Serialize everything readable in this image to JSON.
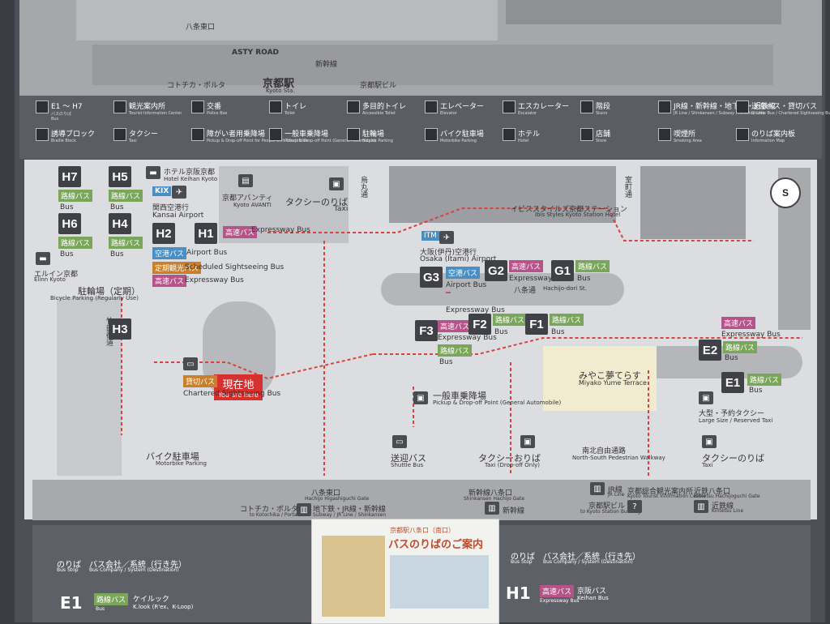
{
  "top_legend": {
    "row1": [
      {
        "key": "range",
        "label": "E1 〜 H7",
        "sub": "バスのりば",
        "sub2": "Bus"
      },
      {
        "key": "info",
        "label": "観光案内所",
        "sub": "Tourist Information Center"
      },
      {
        "key": "police",
        "label": "交番",
        "sub": "Police Box"
      },
      {
        "key": "toilet",
        "label": "トイレ",
        "sub": "Toilet"
      },
      {
        "key": "accessible",
        "label": "多目的トイレ",
        "sub": "Accessible Toilet"
      },
      {
        "key": "elevator",
        "label": "エレベーター",
        "sub": "Elevator"
      },
      {
        "key": "escalator",
        "label": "エスカレーター",
        "sub": "Escalator"
      },
      {
        "key": "stairs",
        "label": "階段",
        "sub": "Stairs"
      },
      {
        "key": "jr",
        "label": "JR線・新幹線・地下鉄・近鉄線",
        "sub": "JR Line / Shinkansen / Subway / Kintetsu Line"
      },
      {
        "key": "shuttle",
        "label": "送迎バス・貸切バス",
        "sub": "Shuttle Bus / Chartered Sightseeing Bus"
      }
    ],
    "row2": [
      {
        "key": "braille",
        "label": "誘導ブロック",
        "sub": "Braille Block"
      },
      {
        "key": "taxi",
        "label": "タクシー",
        "sub": "Taxi"
      },
      {
        "key": "disabled",
        "label": "障がい者用乗降場",
        "sub": "Pickup & Drop-off Point for People with Disabilities"
      },
      {
        "key": "car",
        "label": "一般車乗降場",
        "sub": "Pickup & Drop-off Point (General Automobile)"
      },
      {
        "key": "bicycle",
        "label": "駐輪場",
        "sub": "Bicycle Parking"
      },
      {
        "key": "moto",
        "label": "バイク駐車場",
        "sub": "Motorbike Parking"
      },
      {
        "key": "hotel",
        "label": "ホテル",
        "sub": "Hotel"
      },
      {
        "key": "store",
        "label": "店舗",
        "sub": "Store"
      },
      {
        "key": "smoking",
        "label": "喫煙所",
        "sub": "Smoking Area"
      },
      {
        "key": "infomap",
        "label": "のりば案内板",
        "sub": "Information Map"
      }
    ]
  },
  "top_map": {
    "kyoto_sta": "京都駅",
    "kyoto_sta_en": "Kyoto Sta.",
    "asty": "ASTY ROAD",
    "hachijo": "八条東口",
    "shinkansen": "新幹線",
    "kyoto_bldg": "京都駅ビル",
    "korokan": "コトチカ・ポルタ"
  },
  "map": {
    "stops": [
      {
        "id": "H7",
        "tag": "路線バス",
        "tag_c": "g",
        "en": "Bus"
      },
      {
        "id": "H5",
        "tag": "路線バス",
        "tag_c": "g",
        "en": "Bus"
      },
      {
        "id": "H6",
        "tag": "路線バス",
        "tag_c": "g",
        "en": "Bus"
      },
      {
        "id": "H4",
        "tag": "路線バス",
        "tag_c": "g",
        "en": "Bus"
      },
      {
        "id": "H2",
        "tag": "空港バス",
        "tag_c": "b",
        "en": "Airport Bus"
      },
      {
        "id": "H1",
        "tag": "高速バス",
        "tag_c": "p",
        "en": "Expressway Bus"
      },
      {
        "id": "H3",
        "tag": "",
        "tag_c": "",
        "en": ""
      },
      {
        "id": "G3",
        "tag": "空港バス",
        "tag_c": "b",
        "en": "Airport Bus"
      },
      {
        "id": "G2",
        "tag": "高速バス",
        "tag_c": "p",
        "en": "Expressway Bus"
      },
      {
        "id": "G1",
        "tag": "路線バス",
        "tag_c": "g",
        "en": "Bus"
      },
      {
        "id": "F3",
        "tag": "高速バス",
        "tag_c": "p",
        "en": "Expressway Bus"
      },
      {
        "id": "F2",
        "tag": "路線バス",
        "tag_c": "g",
        "en": "Bus"
      },
      {
        "id": "F1",
        "tag": "路線バス",
        "tag_c": "g",
        "en": "Bus"
      },
      {
        "id": "E2",
        "tag": "高速バス",
        "tag_c": "p",
        "en": "Expressway Bus"
      },
      {
        "id": "E1",
        "tag": "路線バス",
        "tag_c": "g",
        "en": "Bus"
      }
    ],
    "labels": {
      "hotel_keihan": "ホテル京阪京都",
      "hotel_keihan_en": "Hotel Keihan Kyoto",
      "avanti": "京都アバンティ",
      "avanti_en": "Kyoto AVANTI",
      "taxi_stand": "タクシーのりば",
      "taxi_en": "Taxi",
      "kix": "関西空港行",
      "kix_en": "Kansai Airport",
      "kix_code": "KIX",
      "itm": "大阪(伊丹)空港行",
      "itm_en": "Osaka (Itami) Airport",
      "itm_code": "ITM",
      "scheduled": "定期観光バス",
      "scheduled_en": "Scheduled Sightseeing Bus",
      "elnine": "エルイン京都",
      "elnine_en": "Elinn Kyoto",
      "bike_parking": "駐輪場（定期）",
      "bike_parking_en": "Bicycle Parking (Regularly Use)",
      "takeda": "竹田街道",
      "karasuma": "烏丸通",
      "muromachi": "室町通",
      "hachijo_dori": "八条通",
      "hachijo_dori_en": "Hachijo-dori St.",
      "ibis": "イビススタイルズ京都ステーション",
      "ibis_en": "Ibis Styles Kyoto Station Hotel",
      "miyako": "みやこ夢てらす",
      "miyako_en": "Miyako Yume Terrace",
      "here": "現在地",
      "here_en": "You are here",
      "chartered": "貸切バス",
      "chartered_en": "Chartered Sightseeing Bus",
      "general_car": "一般車乗降場",
      "general_car_en": "Pickup & Drop-off Point (General Automobile)",
      "motorbike": "バイク駐車場",
      "motorbike_en": "Motorbike Parking",
      "shuttle": "送迎バス",
      "shuttle_en": "Shuttle Bus",
      "taxi_drop": "タクシーおりば",
      "taxi_drop_en": "Taxi (Drop-off Only)",
      "ns_passage": "南北自由通路",
      "ns_passage_en": "North-South Pedestrian Walkway",
      "large_taxi": "大型・予約タクシー",
      "large_taxi_en": "Large Size / Reserved Taxi",
      "taxi_stand2": "タクシーのりば",
      "hachijo_gate": "八条東口",
      "hachijo_gate_en": "Hachijo Higashiguchi Gate",
      "subway": "地下鉄・JR線・新幹線",
      "subway_en": "Subway / JR Line / Shinkansen",
      "korokan": "コトチカ・ポルタ",
      "korokan_en": "to Kotochika / Porta",
      "shinkansen_gate": "新幹線八条口",
      "shinkansen_gate_en": "Shinkansen Hachijo Gate",
      "shinkansen": "新幹線",
      "jr": "JR線",
      "jr_en": "JR Line",
      "kyoto_bldg": "京都駅ビル",
      "kyoto_bldg_en": "to Kyoto Station Building",
      "info_center": "京都総合観光案内所",
      "info_center_en": "Kyoto Tourist Information Center",
      "kintetsu_gate": "近鉄八条口",
      "kintetsu_gate_en": "Kintetsu Hachijoguchi Gate",
      "kintetsu": "近鉄線",
      "kintetsu_en": "Kintetsu Line",
      "compass": "S"
    }
  },
  "bottom": {
    "left": {
      "stop_hdr": "のりば",
      "stop_hdr_en": "Bus Stop",
      "company_hdr": "バス会社／系統（行き先）",
      "company_hdr_en": "Bus Company / System (Destination)",
      "stop": "E1",
      "tag": "路線バス",
      "tag_en": "Bus",
      "company": "ケイルック",
      "company_en": "K.look (R'ex、K-Loop)"
    },
    "right": {
      "stop_hdr": "のりば",
      "stop_hdr_en": "Bus Stop",
      "company_hdr": "バス会社／系統（行き先）",
      "company_hdr_en": "Bus Company / System (Destination)",
      "stop": "H1",
      "tag": "高速バス",
      "tag_en": "Expressway Bus",
      "company": "京阪バス",
      "company_en": "Keihan Bus"
    },
    "poster": {
      "title": "バスのりばのご案内",
      "subtitle": "京都駅八条口（南口）"
    }
  }
}
